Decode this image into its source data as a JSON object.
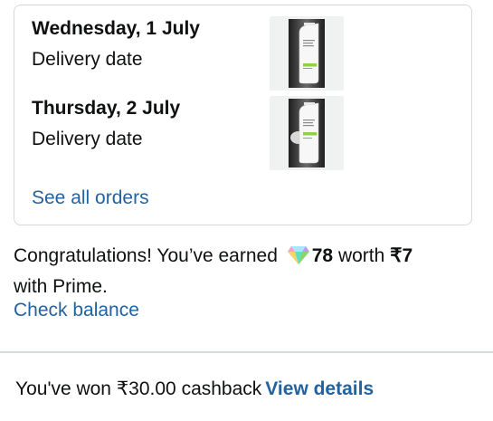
{
  "orders": [
    {
      "date": "Wednesday, 1 July",
      "label": "Delivery date",
      "product_image": "tube-product-image"
    },
    {
      "date": "Thursday, 2 July",
      "label": "Delivery date",
      "product_image": "tube-product-image"
    }
  ],
  "see_all_label": "See all orders",
  "rewards": {
    "text_before": "Congratulations! You’ve earned",
    "gem_icon": "diamond-icon",
    "points": "78",
    "text_middle": "worth",
    "value": "₹7",
    "text_after": "with Prime."
  },
  "check_balance_label": "Check balance",
  "cashback": {
    "text": "You've won ₹30.00 cashback",
    "link_label": "View details"
  },
  "colors": {
    "link": "#2162a1",
    "border": "#d5d9d9",
    "text": "#0f1111"
  }
}
